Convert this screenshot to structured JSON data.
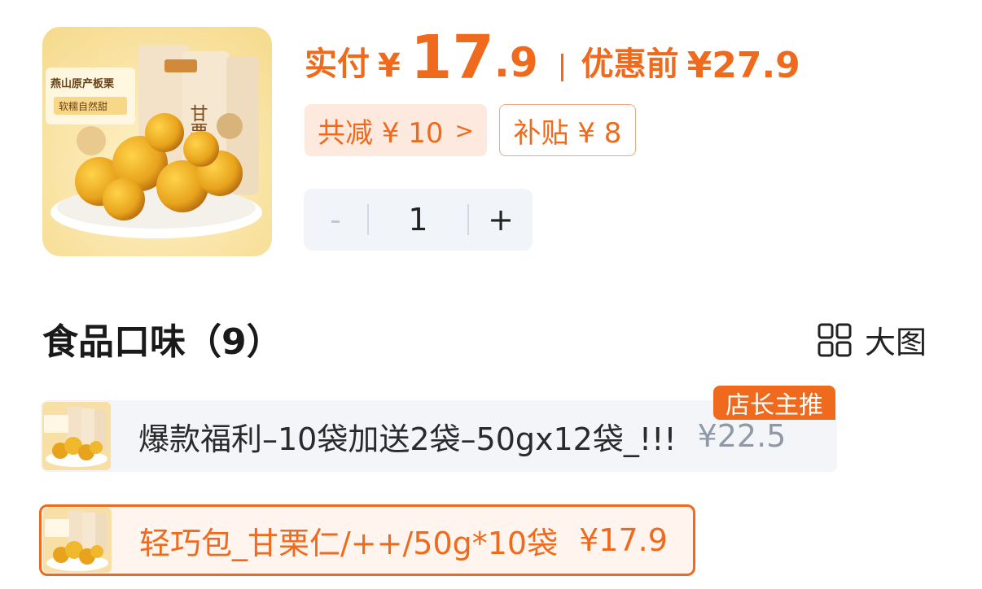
{
  "product": {
    "image_label": "燕山原产板栗",
    "image_sublabel": "软糯自然甜",
    "bag_text": "甘栗仁"
  },
  "price": {
    "pay_label": "实付",
    "currency": "¥",
    "integer": "17",
    "decimal": ".9",
    "orig_label": "优惠前",
    "orig_price": "¥27.9"
  },
  "tags": {
    "discount": "共减 ¥ 10",
    "discount_chevron": ">",
    "subsidy": "补贴 ¥ 8"
  },
  "stepper": {
    "minus": "-",
    "value": "1",
    "plus": "+"
  },
  "section": {
    "title": "食品口味（9）",
    "big_view_label": "大图"
  },
  "variants": [
    {
      "name": "爆款福利–10袋加送2袋–50gx12袋_!!!",
      "price": "¥22.5",
      "badge": "店长主推",
      "selected": false
    },
    {
      "name": "轻巧包_甘栗仁/++/50g*10袋",
      "price": "¥17.9",
      "selected": true
    }
  ],
  "colors": {
    "accent": "#f06a1e",
    "tag_bg": "#fde9dd",
    "stepper_bg": "#f1f5fa",
    "variant_bg": "#f3f5f8"
  }
}
